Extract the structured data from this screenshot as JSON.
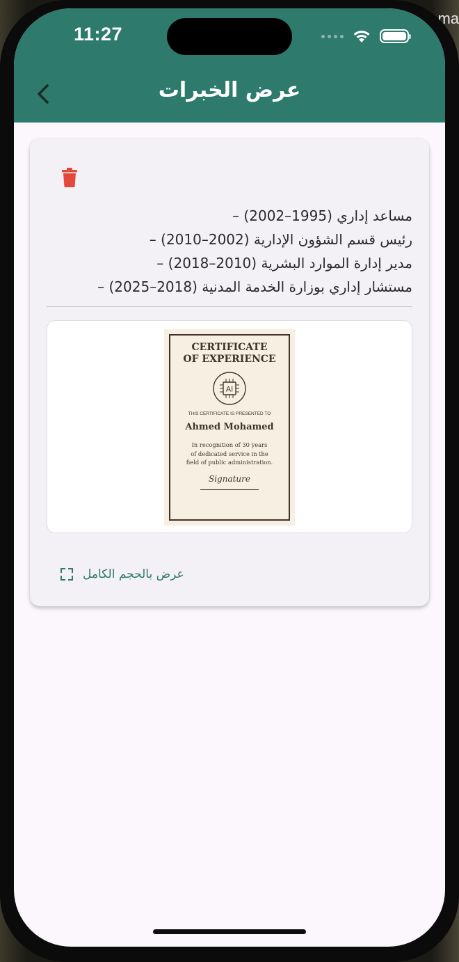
{
  "status_bar": {
    "time": "11:27"
  },
  "header": {
    "title": "عرض الخبرات",
    "back_icon": "chevron-left-icon"
  },
  "background": {
    "peek_text": "ma"
  },
  "card": {
    "delete_icon": "trash-icon",
    "experiences": [
      "مساعد إداري (1995–2002) –",
      "رئيس قسم الشؤون الإدارية (2002–2010) –",
      "مدير إدارة الموارد البشرية (2010–2018) –",
      "مستشار إداري بوزارة الخدمة المدنية (2018–2025) –"
    ],
    "certificate": {
      "title_line1": "CERTIFICATE",
      "title_line2": "OF EXPERIENCE",
      "seal_text": "AI",
      "presented_to": "THIS CERTIFICATE IS PRESENTED TO",
      "name": "Ahmed Mohamed",
      "body_line1": "In recognition of 30 years",
      "body_line2": "of dedicated service in the",
      "body_line3": "field of public administration.",
      "signature": "Signature"
    },
    "full_size_label": "عرض بالحجم الكامل",
    "full_size_icon": "expand-icon"
  },
  "colors": {
    "header": "#2e7a6c",
    "link": "#2e7a6c",
    "delete": "#e0493c",
    "background": "#fbf7fc",
    "card": "#f3f1f6"
  }
}
